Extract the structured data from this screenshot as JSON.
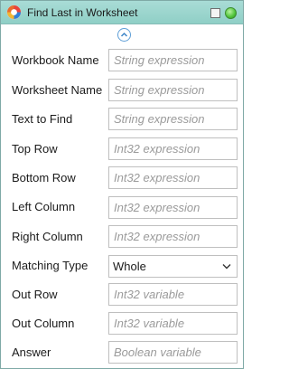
{
  "window": {
    "title": "Find Last in Worksheet"
  },
  "fields": [
    {
      "label": "Workbook Name",
      "placeholder": "String expression"
    },
    {
      "label": "Worksheet Name",
      "placeholder": "String expression"
    },
    {
      "label": "Text to Find",
      "placeholder": "String expression"
    },
    {
      "label": "Top Row",
      "placeholder": "Int32 expression"
    },
    {
      "label": "Bottom Row",
      "placeholder": "Int32 expression"
    },
    {
      "label": "Left Column",
      "placeholder": "Int32 expression"
    },
    {
      "label": "Right Column",
      "placeholder": "Int32 expression"
    },
    {
      "label": "Matching Type",
      "value": "Whole"
    },
    {
      "label": "Out Row",
      "placeholder": "Int32 variable"
    },
    {
      "label": "Out Column",
      "placeholder": "Int32 variable"
    },
    {
      "label": "Answer",
      "placeholder": "Boolean variable"
    }
  ],
  "colors": {
    "title_bar": "#9fd8d0",
    "border": "#7fa9a6",
    "status": "#4fc33a",
    "collapse_accent": "#5e9ed6"
  },
  "icons": {
    "app": "activity-logo-icon",
    "collapse": "chevron-up-icon",
    "dropdown": "chevron-down-icon"
  }
}
